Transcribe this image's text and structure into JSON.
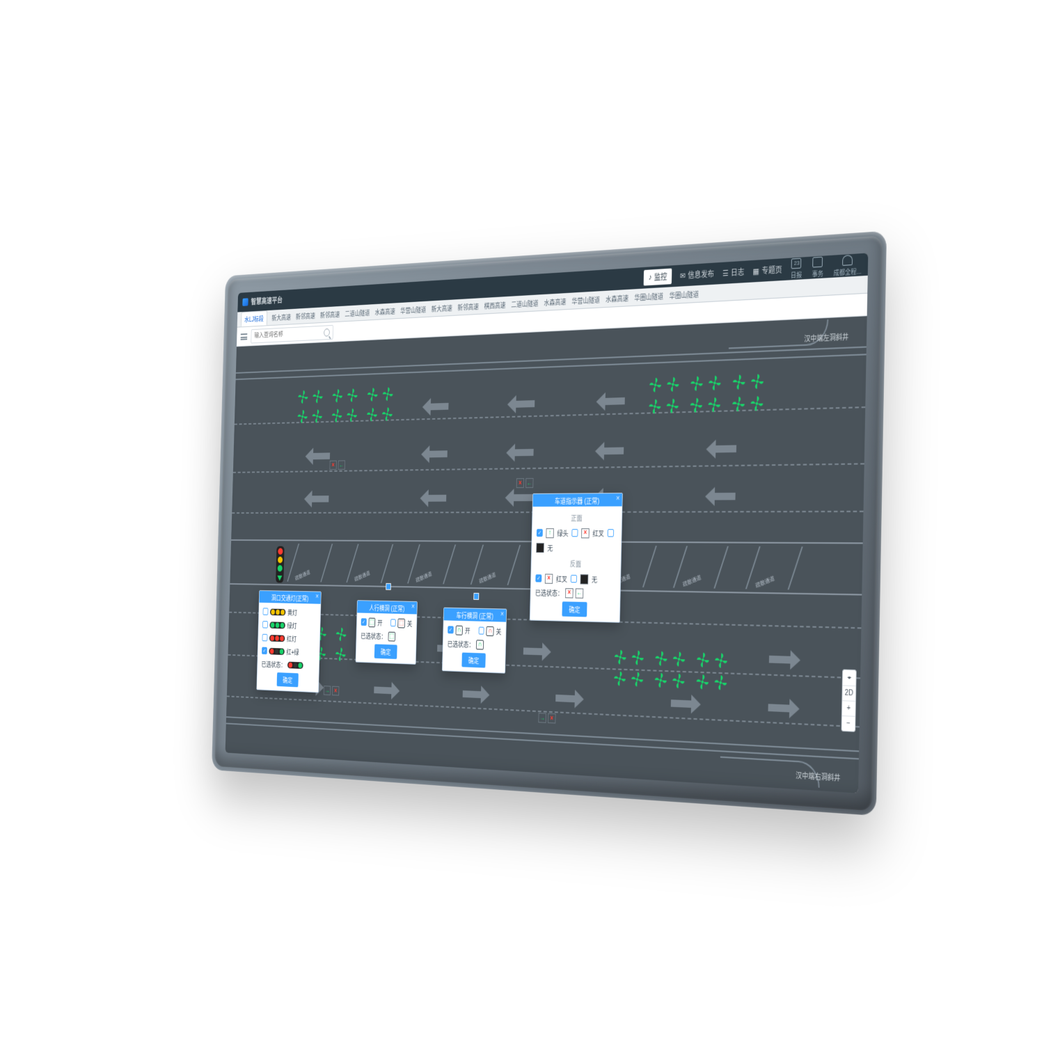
{
  "brand": "智慧高速平台",
  "nav": {
    "monitor": "监控",
    "publish": "信息发布",
    "log": "日志",
    "topic": "专题页"
  },
  "topright": {
    "date_num": "23",
    "date_label": "日报",
    "event": "事务",
    "chengdu": "成都全程..."
  },
  "tabs": [
    "水LJ标段",
    "新大高速",
    "新邻高速",
    "新邻高速",
    "二道山隧道",
    "水森高速",
    "华营山隧道",
    "新大高速",
    "新邻高速",
    "棋西高速",
    "二道山隧道",
    "水森高速",
    "华营山隧道",
    "水森高速",
    "华圈山隧道",
    "华圈山隧道"
  ],
  "search": {
    "placeholder": "输入查询名称"
  },
  "labels": {
    "ramp_left": "汉中端左洞斜井",
    "ramp_right": "汉中端右洞斜井",
    "passage": "疏散通道"
  },
  "mapctl": {
    "locate": "⌖",
    "mode": "2D",
    "plus": "+",
    "minus": "−"
  },
  "popups": {
    "traffic": {
      "title": "洞口交通灯(正常)",
      "opts": [
        "黄灯",
        "绿灯",
        "红灯",
        "红+绿"
      ],
      "status_label": "已选状态：",
      "confirm": "确定"
    },
    "pedestrian": {
      "title": "人行横洞 (正常)",
      "on": "开",
      "off": "关",
      "status_label": "已选状态：",
      "confirm": "确定"
    },
    "vehicle": {
      "title": "车行横洞 (正常)",
      "on": "开",
      "off": "关",
      "status_label": "已选状态：",
      "confirm": "确定"
    },
    "lane": {
      "title": "车道指示器 (正常)",
      "front": "正面",
      "back": "反面",
      "opt_arrow": "绿头",
      "opt_redx": "红叉",
      "opt_none": "无",
      "status_label": "已选状态：",
      "confirm": "确定"
    }
  }
}
